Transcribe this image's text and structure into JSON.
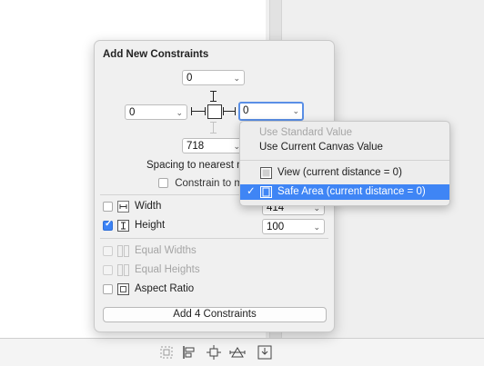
{
  "popover": {
    "title": "Add New Constraints",
    "top_value": "0",
    "left_value": "0",
    "right_value": "0",
    "bottom_value": "718",
    "spacing_label": "Spacing to nearest n",
    "constrain_margins_label": "Constrain to m",
    "rows": {
      "width": {
        "label": "Width",
        "checked": false,
        "value": "414"
      },
      "height": {
        "label": "Height",
        "checked": true,
        "value": "100"
      },
      "equal_widths": {
        "label": "Equal Widths",
        "enabled": false
      },
      "equal_heights": {
        "label": "Equal Heights",
        "enabled": false
      },
      "aspect_ratio": {
        "label": "Aspect Ratio",
        "checked": false
      }
    },
    "add_button_label": "Add 4 Constraints"
  },
  "menu": {
    "use_standard": "Use Standard Value",
    "use_canvas": "Use Current Canvas Value",
    "view_item": "View (current distance = 0)",
    "safe_area_item": "Safe Area (current distance = 0)",
    "check_mark": "✓"
  },
  "colors": {
    "accent": "#3f85f5",
    "focus_ring": "#5a8fe6"
  },
  "bottom_bar": {
    "icons": [
      "update-frames-icon",
      "align-icon",
      "add-constraints-icon",
      "resolve-issues-icon",
      "embed-in-icon"
    ]
  }
}
